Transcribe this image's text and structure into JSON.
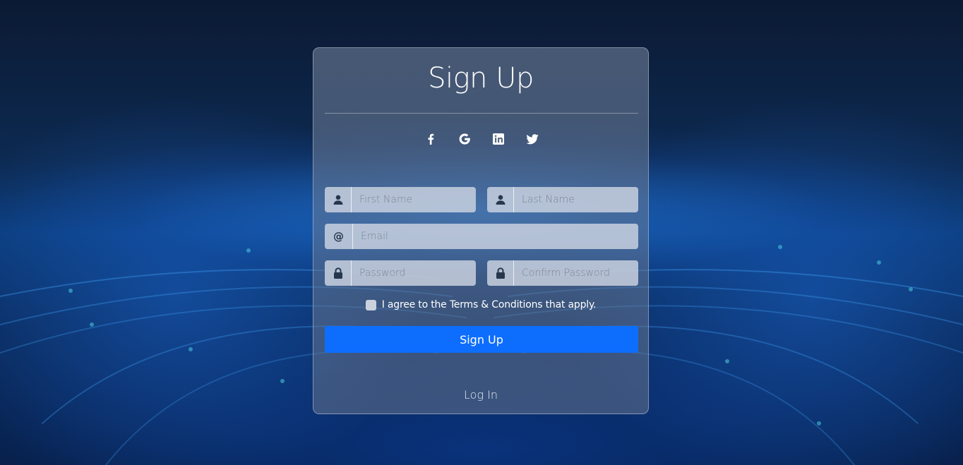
{
  "form": {
    "title": "Sign Up",
    "social": [
      {
        "name": "facebook",
        "icon": "facebook-icon"
      },
      {
        "name": "google",
        "icon": "google-icon"
      },
      {
        "name": "linkedin",
        "icon": "linkedin-icon"
      },
      {
        "name": "twitter",
        "icon": "twitter-icon"
      }
    ],
    "fields": {
      "first_name": {
        "placeholder": "First Name",
        "icon": "user-icon"
      },
      "last_name": {
        "placeholder": "Last Name",
        "icon": "user-icon"
      },
      "email": {
        "placeholder": "Email",
        "icon": "at-icon"
      },
      "password": {
        "placeholder": "Password",
        "icon": "lock-icon"
      },
      "confirm_password": {
        "placeholder": "Confirm Password",
        "icon": "lock-icon"
      }
    },
    "terms_label": "I agree to the Terms & Conditions that apply.",
    "submit_label": "Sign Up",
    "login_label": "Log In"
  },
  "colors": {
    "accent": "#0d6efd",
    "field_bg": "#cdd4e2",
    "icon": "#27374d"
  }
}
